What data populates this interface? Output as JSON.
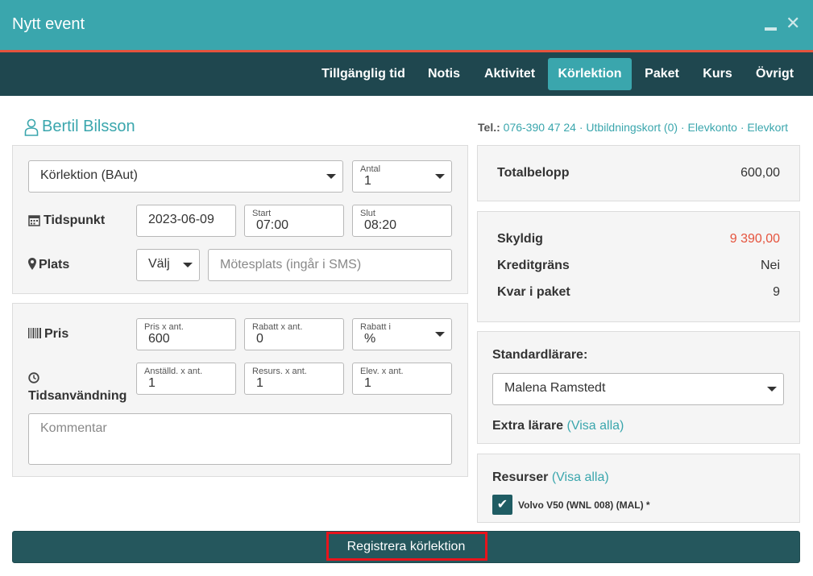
{
  "window": {
    "title": "Nytt event",
    "minimize_icon": "minimize-icon",
    "close_icon": "close-icon",
    "close_glyph": "✕"
  },
  "tabs": [
    {
      "label": "Tillgänglig tid"
    },
    {
      "label": "Notis"
    },
    {
      "label": "Aktivitet"
    },
    {
      "label": "Körlektion",
      "active": true
    },
    {
      "label": "Paket"
    },
    {
      "label": "Kurs"
    },
    {
      "label": "Övrigt"
    }
  ],
  "student": {
    "icon": "user-icon",
    "name": "Bertil Bilsson",
    "tel_label": "Tel.:",
    "phone": "076-390 47 24",
    "sep": " · ",
    "links": [
      "Utbildningskort (0)",
      "Elevkonto",
      "Elevkort"
    ]
  },
  "event": {
    "type_value": "Körlektion (BAut)",
    "antal_label": "Antal",
    "antal_value": "1",
    "tidspunkt_label": "Tidspunkt",
    "tidspunkt_icon": "calendar-icon",
    "date": "2023-06-09",
    "start_label": "Start",
    "start_value": "07:00",
    "slut_label": "Slut",
    "slut_value": "08:20",
    "plats_label": "Plats",
    "plats_icon": "map-marker-icon",
    "plats_select": "Välj",
    "motesplats_placeholder": "Mötesplats (ingår i SMS)"
  },
  "pricing": {
    "pris_label": "Pris",
    "pris_icon": "barcode-icon",
    "pris_field_label": "Pris x ant.",
    "pris_value": "600",
    "rabatt_label": "Rabatt x ant.",
    "rabatt_value": "0",
    "rabatt_i_label": "Rabatt i",
    "rabatt_i_value": "%",
    "tids_label": "Tidsanvändning",
    "tids_icon": "clock-icon",
    "anstalld_label": "Anställd. x ant.",
    "anstalld_value": "1",
    "resurs_label": "Resurs. x ant.",
    "resurs_value": "1",
    "elev_label": "Elev. x ant.",
    "elev_value": "1",
    "kommentar_placeholder": "Kommentar"
  },
  "summary": {
    "totalbelopp_label": "Totalbelopp",
    "totalbelopp_value": "600,00",
    "skyldig_label": "Skyldig",
    "skyldig_value": "9 390,00",
    "kreditgrans_label": "Kreditgräns",
    "kreditgrans_value": "Nei",
    "kvar_label": "Kvar i paket",
    "kvar_value": "9"
  },
  "teachers": {
    "standard_label": "Standardlärare:",
    "standard_value": "Malena Ramstedt",
    "extra_label": "Extra lärare",
    "visa_alla": "(Visa alla)"
  },
  "resources": {
    "label": "Resurser",
    "visa_alla": "(Visa alla)",
    "item_label": "Volvo V50 (WNL 008) (MAL) *",
    "item_checked": true,
    "check_glyph": "✔"
  },
  "submit": {
    "label": "Registrera körlektion"
  },
  "colors": {
    "teal": "#3aa6ad",
    "dark": "#1f474f",
    "accent_red": "#e5533d",
    "highlight": "#e8141c"
  }
}
